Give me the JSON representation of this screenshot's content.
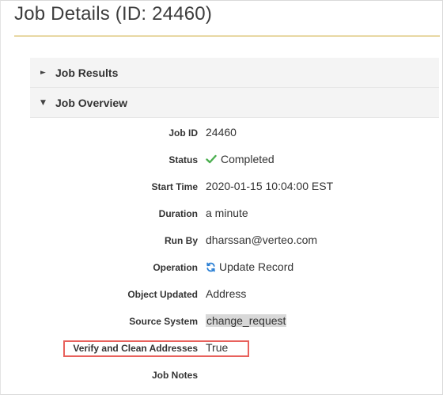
{
  "page": {
    "title": "Job Details (ID: 24460)"
  },
  "sections": [
    {
      "label": "Job Results",
      "expanded": false,
      "arrow": "►"
    },
    {
      "label": "Job Overview",
      "expanded": true,
      "arrow": "▼"
    }
  ],
  "details": {
    "job_id": {
      "label": "Job ID",
      "value": "24460"
    },
    "status": {
      "label": "Status",
      "value": "Completed",
      "icon": "check-icon",
      "icon_color": "#4caf50"
    },
    "start_time": {
      "label": "Start Time",
      "value": "2020-01-15 10:04:00 EST"
    },
    "duration": {
      "label": "Duration",
      "value": "a minute"
    },
    "run_by": {
      "label": "Run By",
      "value": "dharssan@verteo.com"
    },
    "operation": {
      "label": "Operation",
      "value": "Update Record",
      "icon": "refresh-icon",
      "icon_color": "#2a7fd4"
    },
    "object_updated": {
      "label": "Object Updated",
      "value": "Address"
    },
    "source_system": {
      "label": "Source System",
      "value": "change_request"
    },
    "verify_clean": {
      "label": "Verify and Clean Addresses",
      "value": "True",
      "highlighted": true
    },
    "job_notes": {
      "label": "Job Notes",
      "value": ""
    }
  },
  "colors": {
    "title_rule": "#c9a227",
    "highlight_border": "#e8615c",
    "section_header_bg": "#f4f4f4"
  }
}
